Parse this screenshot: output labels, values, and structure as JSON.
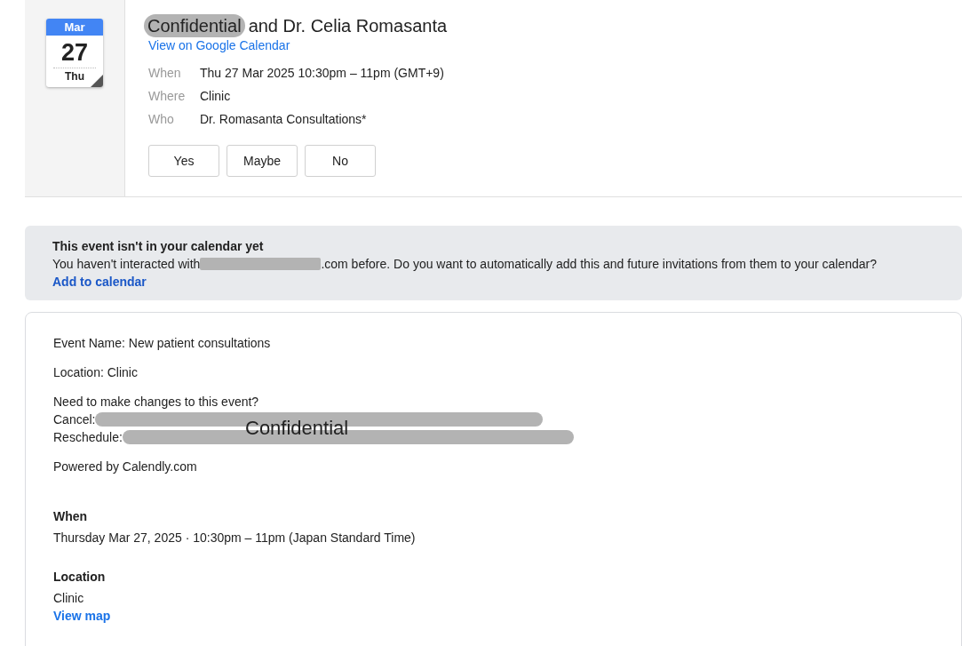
{
  "event": {
    "date_badge": {
      "month": "Mar",
      "day": "27",
      "weekday": "Thu"
    },
    "title": {
      "redaction_label": "Confidential",
      "text": "and Dr. Celia Romasanta"
    },
    "link": "View on Google Calendar",
    "details": [
      {
        "label": "When",
        "value": "Thu 27 Mar 2025 10:30pm – 11pm (GMT+9)"
      },
      {
        "label": "Where",
        "value": "Clinic"
      },
      {
        "label": "Who",
        "value": "Dr. Romasanta Consultations*"
      }
    ],
    "rsvp_buttons": [
      "Yes",
      "Maybe",
      "No"
    ]
  },
  "notice": {
    "heading": "This event isn't in your calendar yet",
    "text_before": "You haven't interacted with",
    "text_after": ".com before. Do you want to automatically add this and future invitations from them to your calendar?",
    "action": "Add to calendar"
  },
  "description": {
    "paragraphs": [
      "Event Name: New patient consultations",
      "Location: Clinic"
    ],
    "changes": {
      "heading": "Need to make changes to this event?",
      "lines": [
        "Cancel:",
        "Reschedule:"
      ],
      "redaction_label": "Confidential"
    },
    "powered": "Powered by Calendly.com",
    "sections": [
      {
        "heading": "When",
        "lines": [
          "Thursday Mar 27, 2025 · 10:30pm – 11pm (Japan Standard Time)"
        ]
      },
      {
        "heading": "Location",
        "lines": [
          "Clinic"
        ],
        "link": "View map"
      }
    ]
  }
}
